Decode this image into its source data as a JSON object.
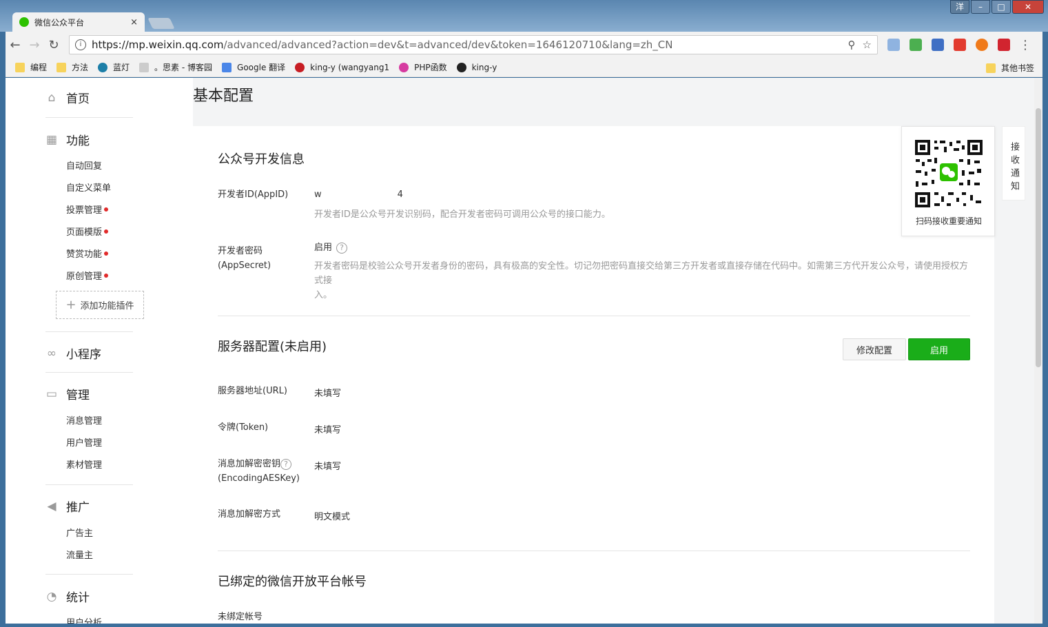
{
  "browser": {
    "tab_title": "微信公众平台",
    "tab_close": "×",
    "window_user": "洋",
    "window_min": "–",
    "window_max": "□",
    "window_close": "✕",
    "url_host": "https://mp.weixin.qq.com",
    "url_path": "/advanced/advanced?action=dev&t=advanced/dev&token=1646120710&lang=zh_CN",
    "bookmarks": [
      "编程",
      "方法",
      "蓝灯",
      "。思素 - 博客园",
      "Google 翻译",
      "king-y (wangyang1",
      "PHP函数",
      "king-y"
    ],
    "bookmarks_other": "其他书签"
  },
  "sidebar": {
    "home": "首页",
    "features": "功能",
    "features_items": [
      "自动回复",
      "自定义菜单",
      "投票管理",
      "页面模版",
      "赞赏功能",
      "原创管理"
    ],
    "add_plugin": "添加功能插件",
    "miniprogram": "小程序",
    "manage": "管理",
    "manage_items": [
      "消息管理",
      "用户管理",
      "素材管理"
    ],
    "promote": "推广",
    "promote_items": [
      "广告主",
      "流量主"
    ],
    "stats": "统计",
    "stats_items": [
      "用户分析"
    ]
  },
  "main": {
    "page_title": "基本配置",
    "dev_info": {
      "title": "公众号开发信息",
      "appid_label": "开发者ID(AppID)",
      "appid_value_start": "w",
      "appid_value_end": "4",
      "appid_desc": "开发者ID是公众号开发识别码，配合开发者密码可调用公众号的接口能力。",
      "secret_label_1": "开发者密码",
      "secret_label_2": "(AppSecret)",
      "secret_value": "启用",
      "secret_desc_1": "开发者密码是校验公众号开发者身份的密码，具有极高的安全性。切记勿把密码直接交给第三方开发者或直接存储在代码中。如需第三方代开发公众号，请使用授权方式接",
      "secret_desc_2": "入。"
    },
    "server": {
      "title": "服务器配置(未启用)",
      "modify_button": "修改配置",
      "enable_button": "启用",
      "url_label": "服务器地址(URL)",
      "url_value": "未填写",
      "token_label": "令牌(Token)",
      "token_value": "未填写",
      "aes_label_1": "消息加解密密钥",
      "aes_label_2": "(EncodingAESKey)",
      "aes_value": "未填写",
      "mode_label": "消息加解密方式",
      "mode_value": "明文模式"
    },
    "open_platform": {
      "title": "已绑定的微信开放平台帐号",
      "status": "未绑定帐号"
    },
    "qr_caption": "扫码接收重要通知",
    "notify_tab": "接收通知"
  },
  "colors": {
    "accent_green": "#1aad19",
    "red_dot": "#e12b2b"
  }
}
